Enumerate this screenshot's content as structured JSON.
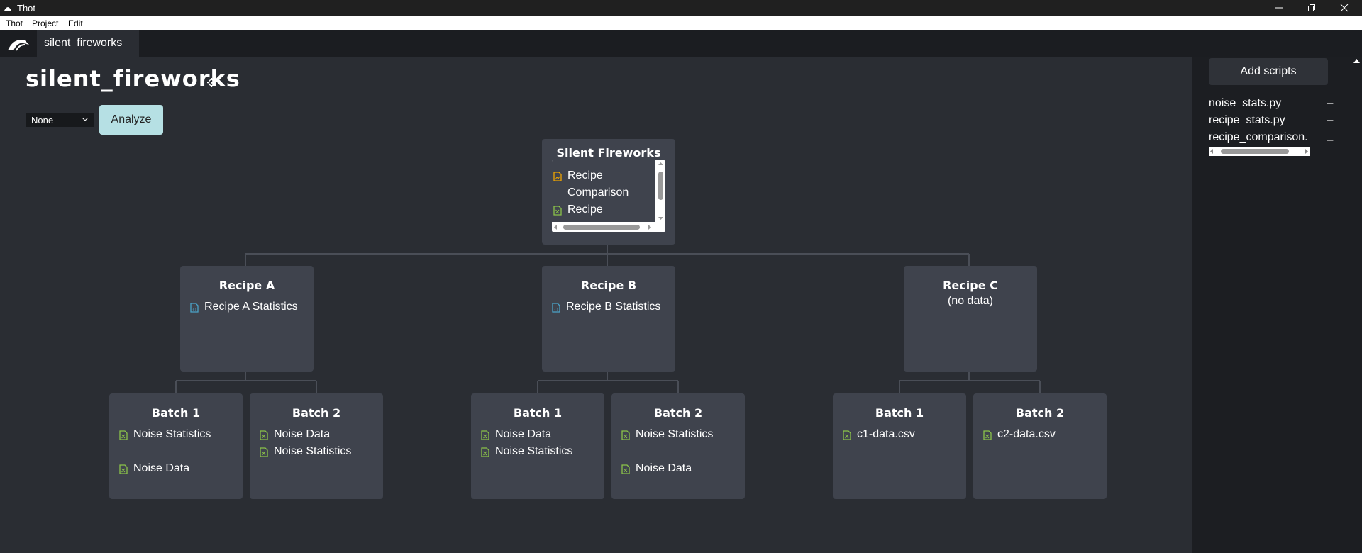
{
  "window": {
    "title": "Thot",
    "minimize_glyph": "minimize-icon",
    "maximize_glyph": "restore-icon",
    "close_glyph": "close-icon"
  },
  "menu": [
    "Thot",
    "Project",
    "Edit"
  ],
  "tab": {
    "label": "silent_fireworks"
  },
  "project": {
    "title": "silent_fireworks",
    "select_value": "None",
    "analyze_label": "Analyze"
  },
  "tree": {
    "root": {
      "title": "Silent Fireworks",
      "assets": [
        {
          "label": "Recipe Comparison",
          "icon": "image-file-icon"
        },
        {
          "label": "Recipe",
          "icon": "csv-file-icon"
        }
      ]
    },
    "recipes": [
      {
        "title": "Recipe A",
        "subtitle": "",
        "assets": [
          {
            "label": "Recipe A Statistics",
            "icon": "json-file-icon"
          }
        ],
        "batches": [
          {
            "title": "Batch 1",
            "assets": [
              {
                "label": "Noise Statistics",
                "icon": "csv-file-icon"
              },
              {
                "label": "Noise Data",
                "icon": "csv-file-icon"
              }
            ]
          },
          {
            "title": "Batch 2",
            "assets": [
              {
                "label": "Noise Data",
                "icon": "csv-file-icon"
              },
              {
                "label": "Noise Statistics",
                "icon": "csv-file-icon"
              }
            ]
          }
        ]
      },
      {
        "title": "Recipe B",
        "subtitle": "",
        "assets": [
          {
            "label": "Recipe B Statistics",
            "icon": "json-file-icon"
          }
        ],
        "batches": [
          {
            "title": "Batch 1",
            "assets": [
              {
                "label": "Noise Data",
                "icon": "csv-file-icon"
              },
              {
                "label": "Noise Statistics",
                "icon": "csv-file-icon"
              }
            ]
          },
          {
            "title": "Batch 2",
            "assets": [
              {
                "label": "Noise Statistics",
                "icon": "csv-file-icon"
              },
              {
                "label": "Noise Data",
                "icon": "csv-file-icon"
              }
            ]
          }
        ]
      },
      {
        "title": "Recipe C",
        "subtitle": "(no data)",
        "assets": [],
        "batches": [
          {
            "title": "Batch 1",
            "assets": [
              {
                "label": "c1-data.csv",
                "icon": "csv-file-icon"
              }
            ]
          },
          {
            "title": "Batch 2",
            "assets": [
              {
                "label": "c2-data.csv",
                "icon": "csv-file-icon"
              }
            ]
          }
        ]
      }
    ]
  },
  "scripts": {
    "add_label": "Add scripts",
    "items": [
      {
        "name": "noise_stats.py",
        "remove": "–"
      },
      {
        "name": "recipe_stats.py",
        "remove": "–"
      },
      {
        "name": "recipe_comparison.py",
        "remove": "–"
      }
    ]
  },
  "colors": {
    "background": "#2a2d33",
    "node": "#3f434d",
    "accent_button": "#b6e0e4",
    "csv_icon": "#8bc34a",
    "image_icon": "#f0a500",
    "json_icon": "#4aa3c8"
  }
}
